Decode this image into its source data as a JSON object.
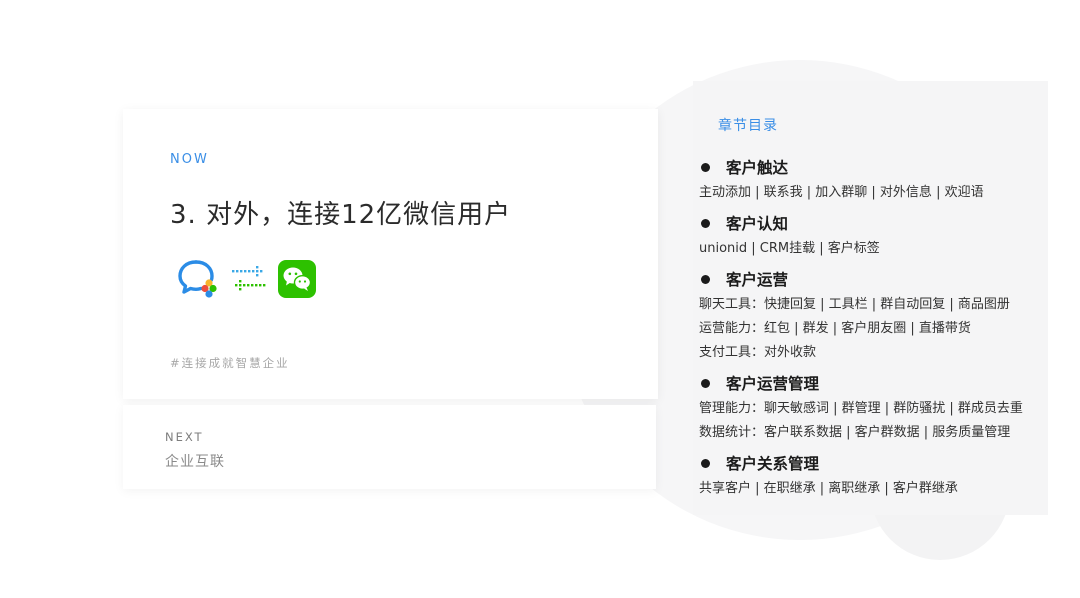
{
  "now_card": {
    "label": "NOW",
    "title": "3. 对外，连接12亿微信用户",
    "tagline": "#连接成就智慧企业",
    "icons": [
      "wework-icon",
      "exchange-arrows-icon",
      "wechat-icon"
    ],
    "colors": {
      "accent": "#3a8ee6",
      "wechat_green": "#2dc100",
      "wework_blue": "#2b8ce6"
    }
  },
  "next_card": {
    "label": "NEXT",
    "title": "企业互联"
  },
  "toc": {
    "heading": "章节目录",
    "sections": [
      {
        "title": "客户触达",
        "lines": [
          "主动添加 | 联系我 | 加入群聊 | 对外信息 | 欢迎语"
        ]
      },
      {
        "title": "客户认知",
        "lines": [
          "unionid | CRM挂载 | 客户标签"
        ]
      },
      {
        "title": "客户运营",
        "lines": [
          "聊天工具：快捷回复 | 工具栏 | 群自动回复 | 商品图册",
          "运营能力：红包 | 群发 | 客户朋友圈 |  直播带货",
          "支付工具：对外收款"
        ]
      },
      {
        "title": "客户运营管理",
        "lines": [
          "管理能力：聊天敏感词 | 群管理 | 群防骚扰 | 群成员去重",
          "数据统计：客户联系数据 | 客户群数据 |  服务质量管理"
        ]
      },
      {
        "title": "客户关系管理",
        "lines": [
          "共享客户 | 在职继承 | 离职继承 | 客户群继承"
        ]
      }
    ]
  }
}
